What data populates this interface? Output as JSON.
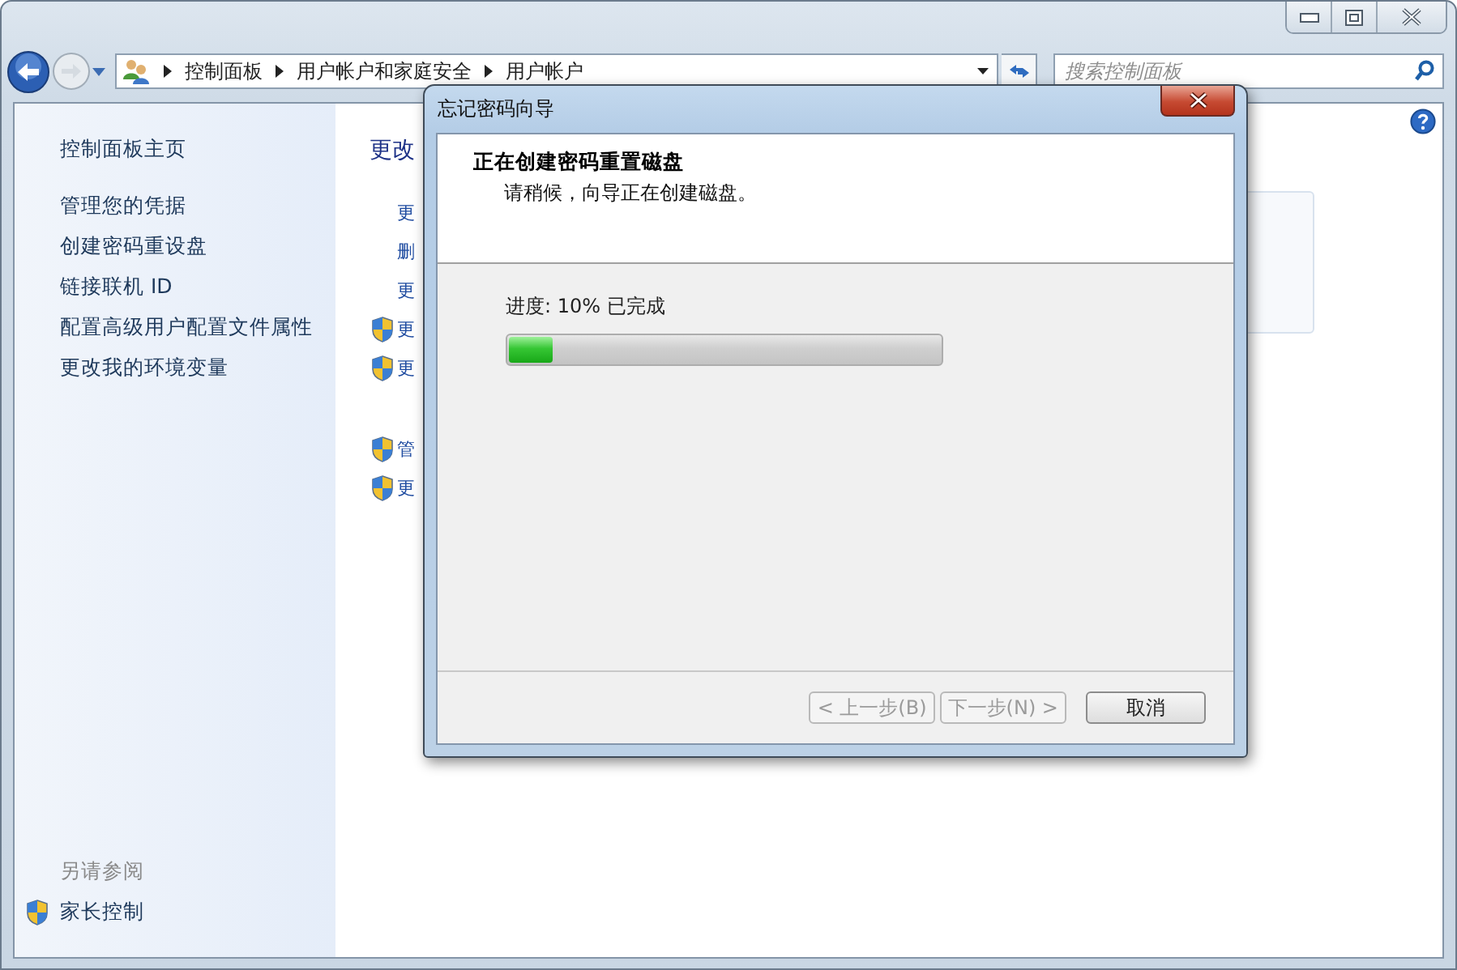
{
  "address_bar": {
    "breadcrumbs": [
      "控制面板",
      "用户帐户和家庭安全",
      "用户帐户"
    ]
  },
  "search": {
    "placeholder": "搜索控制面板"
  },
  "sidebar": {
    "items": [
      {
        "label": "控制面板主页"
      },
      {
        "label": "管理您的凭据"
      },
      {
        "label": "创建密码重设盘"
      },
      {
        "label": "链接联机 ID"
      },
      {
        "label": "配置高级用户配置文件属性"
      },
      {
        "label": "更改我的环境变量"
      }
    ],
    "see_also_title": "另请参阅",
    "see_also": [
      {
        "label": "家长控制",
        "shield": true
      }
    ]
  },
  "main": {
    "heading": "更改",
    "groups": [
      [
        {
          "label": "更",
          "shield": false
        },
        {
          "label": "删",
          "shield": false
        },
        {
          "label": "更",
          "shield": false
        },
        {
          "label": "更",
          "shield": true
        },
        {
          "label": "更",
          "shield": true
        }
      ],
      [
        {
          "label": "管",
          "shield": true
        },
        {
          "label": "更",
          "shield": true
        }
      ]
    ]
  },
  "dialog": {
    "title": "忘记密码向导",
    "heading": "正在创建密码重置磁盘",
    "subtitle": "请稍候，向导正在创建磁盘。",
    "progress_label": "进度: 10% 已完成",
    "progress": {
      "level": 0.1
    },
    "buttons": [
      {
        "label": "< 上一步(B)",
        "disabled": true
      },
      {
        "label": "下一步(N) >",
        "disabled": true
      },
      {
        "label": "取消",
        "disabled": false
      }
    ]
  }
}
